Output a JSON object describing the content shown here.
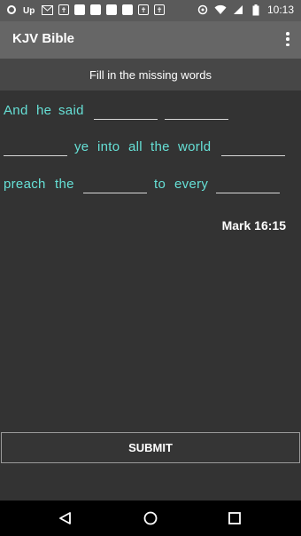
{
  "status_bar": {
    "time": "10:13",
    "left_icons": [
      "ring-icon",
      "upwork-icon",
      "gmail-icon",
      "bible-icon",
      "app-icon-1",
      "app-icon-2",
      "app-icon-3",
      "app-icon-4",
      "bible-icon",
      "bible-icon"
    ]
  },
  "app_bar": {
    "title": "KJV Bible"
  },
  "instruction": "Fill in the missing words",
  "verse": {
    "line1": [
      "And",
      "he",
      "said"
    ],
    "line2": [
      "ye",
      "into",
      "all",
      "the",
      "world"
    ],
    "line3a": [
      "preach",
      "the"
    ],
    "line3b": [
      "to",
      "every"
    ],
    "reference": "Mark 16:15"
  },
  "submit_label": "SUBMIT",
  "colors": {
    "background": "#333333",
    "app_bar": "#666666",
    "verse_text": "#66e0d6",
    "status_bar": "#5a5a5a"
  }
}
